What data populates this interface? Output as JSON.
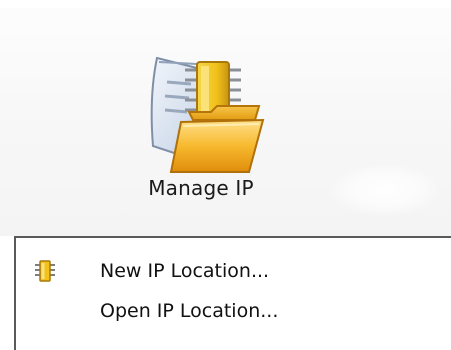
{
  "ribbon": {
    "manage_ip": {
      "label": "Manage IP",
      "icon": "manage-ip-icon"
    }
  },
  "menu": {
    "items": [
      {
        "label": "New IP Location...",
        "icon": "ip-chip-icon"
      },
      {
        "label": "Open IP Location...",
        "icon": ""
      }
    ]
  },
  "colors": {
    "folder": "#f5b731",
    "chip": "#f2c21b",
    "document": "#c9d6e8",
    "menu_border": "#5a5a5a"
  }
}
